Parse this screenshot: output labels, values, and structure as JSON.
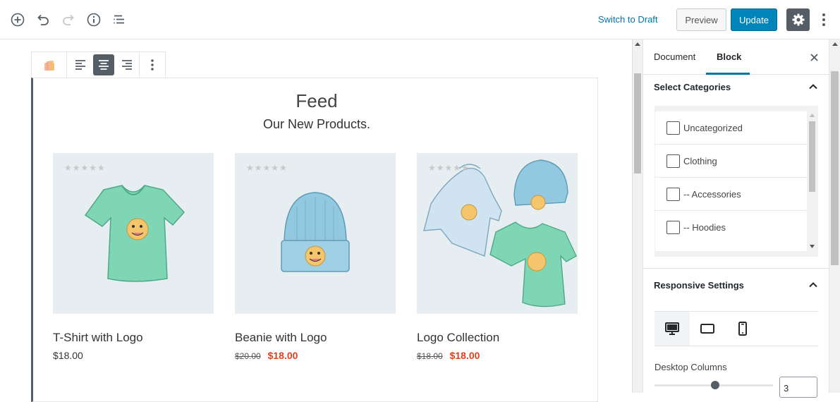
{
  "topbar": {
    "switch_draft": "Switch to Draft",
    "preview": "Preview",
    "update": "Update"
  },
  "block": {
    "title": "Feed",
    "subtitle": "Our New Products.",
    "active_alignment": "center"
  },
  "products": [
    {
      "name": "T-Shirt with Logo",
      "price": "$18.00",
      "old_price": "",
      "sale_price": ""
    },
    {
      "name": "Beanie with Logo",
      "price": "",
      "old_price": "$20.00",
      "sale_price": "$18.00"
    },
    {
      "name": "Logo Collection",
      "price": "",
      "old_price": "$18.00",
      "sale_price": "$18.00"
    }
  ],
  "stars": "★★★★★",
  "sidebar": {
    "tabs": {
      "document": "Document",
      "block": "Block"
    },
    "active_tab": "Block",
    "select_categories": {
      "title": "Select Categories",
      "items": [
        "Uncategorized",
        "Clothing",
        "-- Accessories",
        "-- Hoodies"
      ]
    },
    "responsive": {
      "title": "Responsive Settings",
      "active_device": "desktop",
      "desktop_columns_label": "Desktop Columns",
      "desktop_columns_value": "3"
    }
  },
  "colors": {
    "accent": "#0073aa",
    "update_button": "#0085ba",
    "sale_price": "#e2401c",
    "tshirt": "#7fd6b4",
    "beanie": "#93c9e0"
  }
}
